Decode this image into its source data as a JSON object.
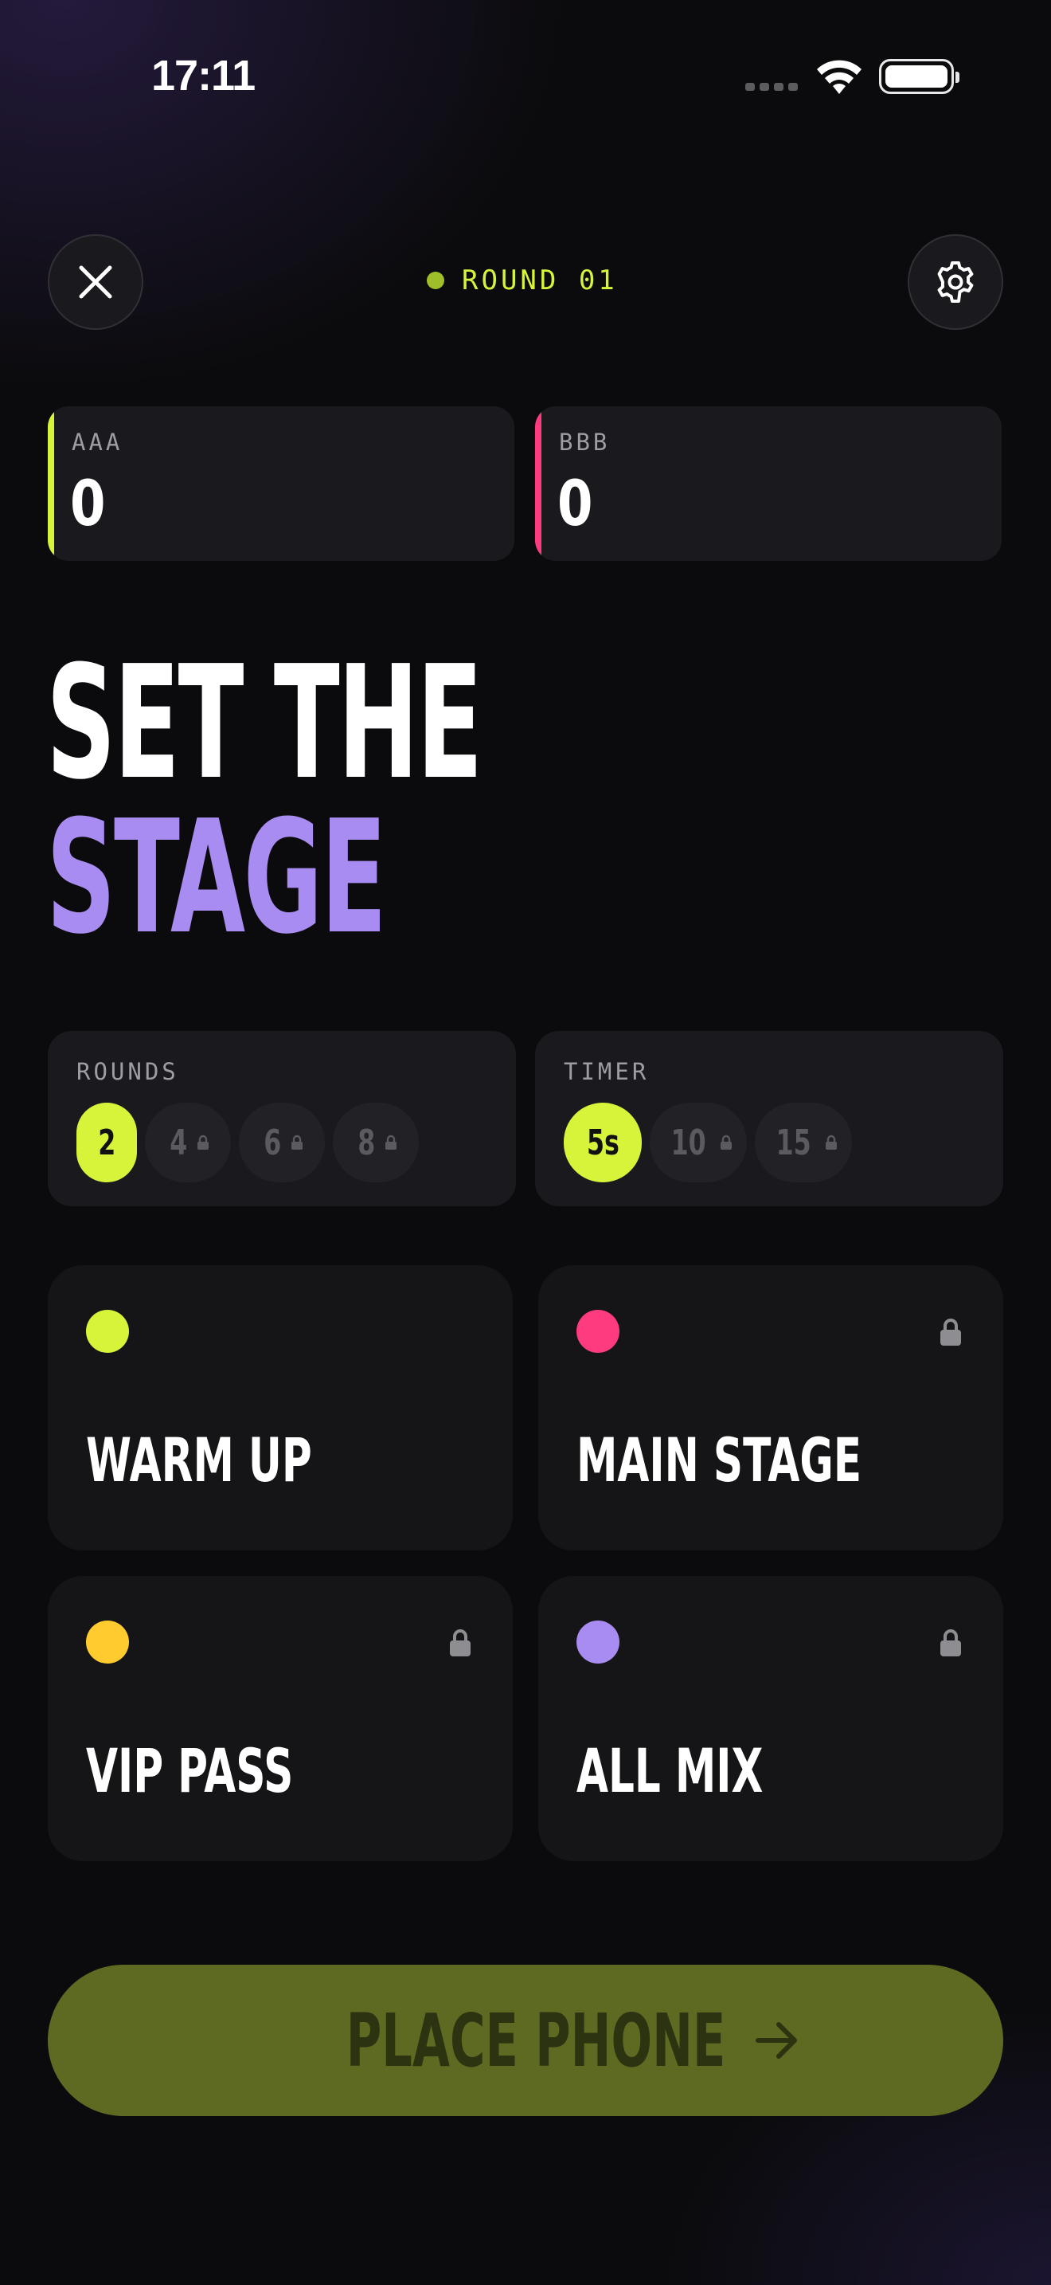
{
  "status_bar": {
    "time": "17:11"
  },
  "header": {
    "round_label": "ROUND 01"
  },
  "scores": [
    {
      "name": "AAA",
      "value": "0",
      "color": "#d7f33a"
    },
    {
      "name": "BBB",
      "value": "0",
      "color": "#ff3b7f"
    }
  ],
  "title": {
    "line1": "SET THE",
    "line2": "STAGE"
  },
  "rounds": {
    "label": "ROUNDS",
    "options": [
      {
        "value": "2",
        "selected": true,
        "locked": false
      },
      {
        "value": "4",
        "selected": false,
        "locked": true
      },
      {
        "value": "6",
        "selected": false,
        "locked": true
      },
      {
        "value": "8",
        "selected": false,
        "locked": true
      }
    ]
  },
  "timer": {
    "label": "TIMER",
    "options": [
      {
        "value": "5s",
        "selected": true,
        "locked": false
      },
      {
        "value": "10",
        "selected": false,
        "locked": true
      },
      {
        "value": "15",
        "selected": false,
        "locked": true
      }
    ]
  },
  "modes": [
    {
      "name": "WARM UP",
      "color": "#d7f33a",
      "locked": false,
      "icon": "dot"
    },
    {
      "name": "MAIN STAGE",
      "color": "#ff3b7f",
      "locked": true,
      "icon": "lock-icon"
    },
    {
      "name": "VIP PASS",
      "color": "#ffcb2f",
      "locked": true,
      "icon": "lock-icon"
    },
    {
      "name": "ALL MIX",
      "color": "#a98cf2",
      "locked": true,
      "icon": "lock-icon"
    }
  ],
  "cta": {
    "label": "PLACE PHONE",
    "icon": "arrow-right-icon"
  },
  "colors": {
    "accent": "#d7f33a",
    "purple": "#a98cf2",
    "pink": "#ff3b7f",
    "yellow": "#ffcb2f"
  }
}
